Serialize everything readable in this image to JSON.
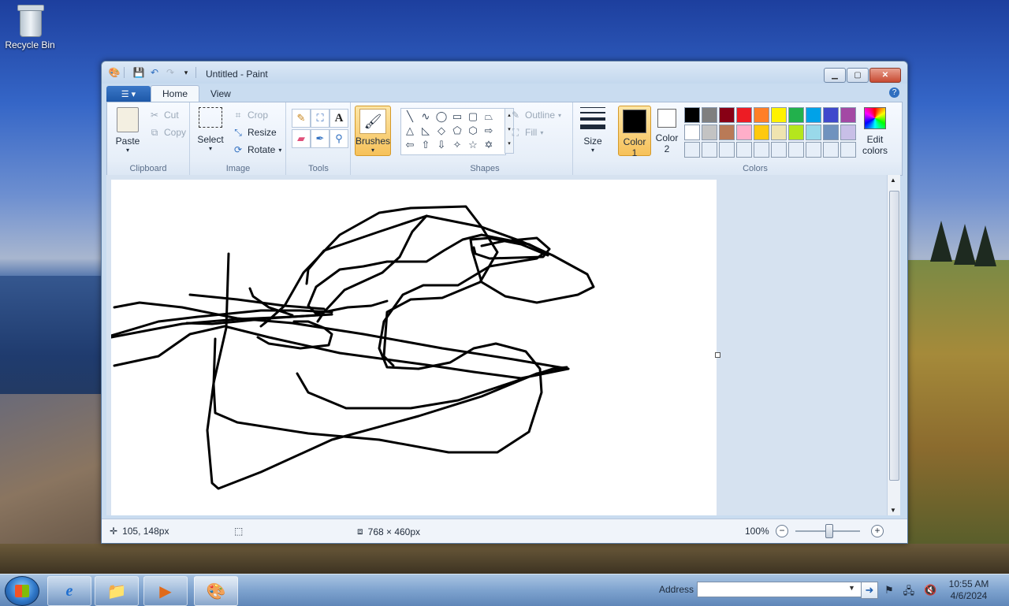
{
  "desktop": {
    "icons": [
      {
        "label": "Recycle Bin",
        "icon": "recycle-bin-icon"
      }
    ]
  },
  "window": {
    "title": "Untitled - Paint",
    "tabs": [
      {
        "label": "Home"
      },
      {
        "label": "View"
      }
    ],
    "ribbon": {
      "clipboard": {
        "label": "Clipboard",
        "paste": "Paste",
        "cut": "Cut",
        "copy": "Copy"
      },
      "image": {
        "label": "Image",
        "select": "Select",
        "crop": "Crop",
        "resize": "Resize",
        "rotate": "Rotate"
      },
      "tools": {
        "label": "Tools"
      },
      "brushes": {
        "label": "Brushes"
      },
      "shapes": {
        "label": "Shapes",
        "outline": "Outline",
        "fill": "Fill"
      },
      "size": {
        "label": "Size"
      },
      "colors": {
        "label": "Colors",
        "color1": "Color",
        "color1_num": "1",
        "color2": "Color",
        "color2_num": "2",
        "edit": "Edit",
        "edit2": "colors",
        "color1_value": "#000000",
        "color2_value": "#ffffff",
        "palette_row1": [
          "#000000",
          "#7f7f7f",
          "#880015",
          "#ed1c24",
          "#ff7f27",
          "#fff200",
          "#22b14c",
          "#00a2e8",
          "#3f48cc",
          "#a349a4"
        ],
        "palette_row2": [
          "#ffffff",
          "#c3c3c3",
          "#b97a57",
          "#ffaec9",
          "#ffc90e",
          "#efe4b0",
          "#b5e61d",
          "#99d9ea",
          "#7092be",
          "#c8bfe7"
        ]
      }
    },
    "status": {
      "cursor_pos": "105, 148px",
      "image_size": "768 × 460px",
      "zoom": "100%"
    }
  },
  "taskbar": {
    "address_label": "Address",
    "address_value": "",
    "time": "10:55 AM",
    "date": "4/6/2024"
  }
}
